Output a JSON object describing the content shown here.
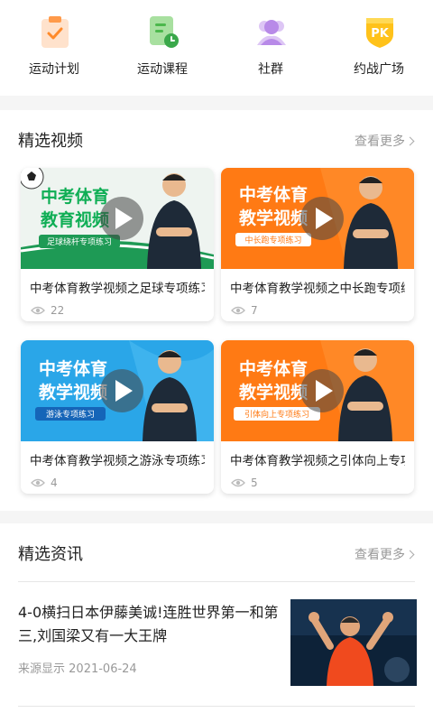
{
  "quick_nav": [
    {
      "label": "运动计划",
      "icon": "clipboard-check-icon"
    },
    {
      "label": "运动课程",
      "icon": "course-clock-icon"
    },
    {
      "label": "社群",
      "icon": "community-people-icon"
    },
    {
      "label": "约战广场",
      "icon": "pk-shield-icon"
    }
  ],
  "videos": {
    "title": "精选视频",
    "more": "查看更多",
    "items": [
      {
        "title": "中考体育教学视频之足球专项练习",
        "views": "22",
        "thumb_line1": "中考体育",
        "thumb_line2": "教育视频",
        "thumb_tag": "足球绕杆专项练习"
      },
      {
        "title": "中考体育教学视频之中长跑专项练习",
        "views": "7",
        "thumb_line1": "中考体育",
        "thumb_line2": "教学视频",
        "thumb_tag": "中长跑专项练习"
      },
      {
        "title": "中考体育教学视频之游泳专项练习",
        "views": "4",
        "thumb_line1": "中考体育",
        "thumb_line2": "教学视频",
        "thumb_tag": "游泳专项练习"
      },
      {
        "title": "中考体育教学视频之引体向上专项练习",
        "views": "5",
        "thumb_line1": "中考体育",
        "thumb_line2": "教学视频",
        "thumb_tag": "引体向上专项练习"
      }
    ]
  },
  "news": {
    "title": "精选资讯",
    "more": "查看更多",
    "items": [
      {
        "title": "4-0横扫日本伊藤美诚!连胜世界第一和第三,刘国梁又有一大王牌",
        "source": "来源显示",
        "date": "2021-06-24"
      }
    ]
  },
  "colors": {
    "orange": "#ff7a14",
    "blue": "#2aa6e8",
    "green": "#1e9a55",
    "page_bg": "#f5f5f5"
  }
}
